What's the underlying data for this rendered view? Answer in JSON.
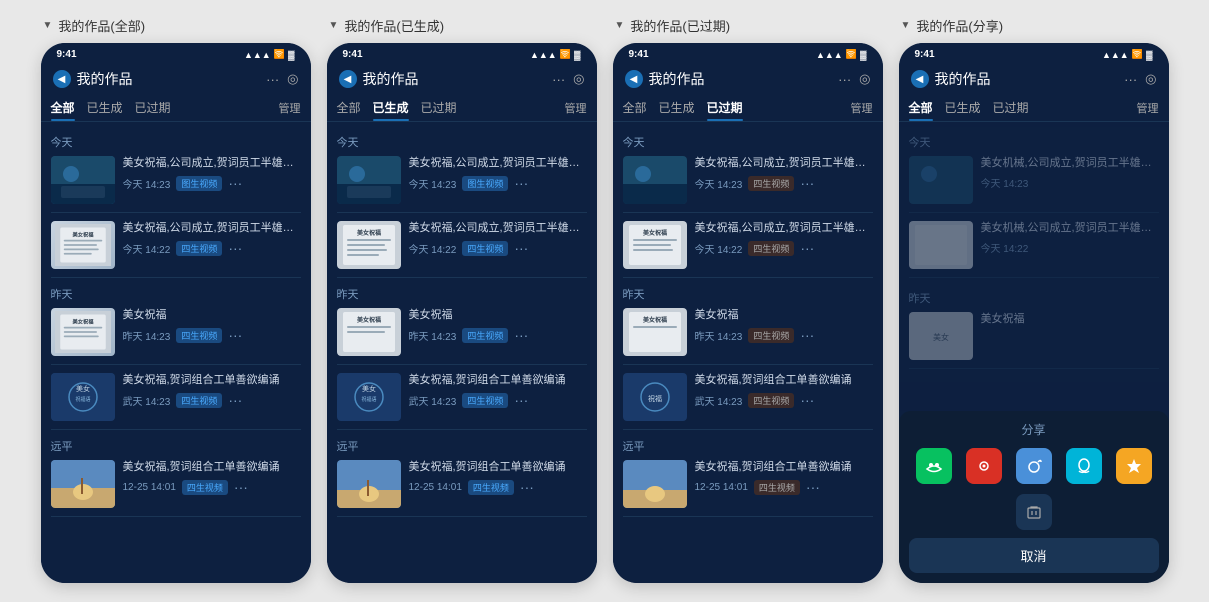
{
  "sections": [
    {
      "id": "all",
      "title": "我的作品(全部)",
      "tabs": [
        "全部",
        "已生成",
        "已过期"
      ],
      "activeTab": 0,
      "manageLabel": "管理"
    },
    {
      "id": "generated",
      "title": "我的作品(已生成)",
      "tabs": [
        "全部",
        "已生成",
        "已过期"
      ],
      "activeTab": 1,
      "manageLabel": "管理"
    },
    {
      "id": "expired",
      "title": "我的作品(已过期)",
      "tabs": [
        "全部",
        "已生成",
        "已过期"
      ],
      "activeTab": 2,
      "manageLabel": "管理"
    },
    {
      "id": "share",
      "title": "我的作品(分享)",
      "tabs": [
        "全部",
        "已生成",
        "已过期"
      ],
      "activeTab": 0,
      "manageLabel": "管理"
    }
  ],
  "header": {
    "title": "我的作品",
    "backLabel": "←",
    "moreLabel": "···",
    "settingLabel": "◎"
  },
  "statusBar": {
    "time": "9:41",
    "icons": "📶🔋"
  },
  "dateSections": {
    "today": "今天",
    "yesterday": "昨天",
    "earlier": "远平"
  },
  "workItems": [
    {
      "id": 1,
      "title": "美女祝福,公司成立,贺词员工半雄改福迪,智能生成",
      "time": "今天 14:23",
      "status": "图生视频",
      "statusType": "generated",
      "thumbType": "photo"
    },
    {
      "id": 2,
      "title": "美女祝福,公司成立,贺词员工半雄改福迪,智能生成",
      "time": "今天 14:22",
      "status": "四生视频",
      "statusType": "generated",
      "thumbType": "card"
    },
    {
      "id": 3,
      "title": "美女祝福",
      "time": "昨天 14:23",
      "status": "四生视频",
      "statusType": "generated",
      "thumbType": "card"
    },
    {
      "id": 4,
      "title": "美女祝福,贺词组合工单善欲编诵",
      "time": "武天 14:23",
      "status": "四生视频",
      "statusType": "generated",
      "thumbType": "blue-poster"
    },
    {
      "id": 5,
      "title": "美女祝福,贺词组合工单善欲编诵",
      "time": "12-25 14:01",
      "status": "四生视频",
      "statusType": "generated",
      "thumbType": "beach"
    }
  ],
  "sharePanel": {
    "sectionLabel": "分享",
    "cancelLabel": "取消",
    "apps": [
      {
        "id": "wechat",
        "label": "微信",
        "color": "green"
      },
      {
        "id": "moments",
        "label": "朋友圈",
        "color": "red"
      },
      {
        "id": "weibo",
        "label": "微博",
        "color": "blue"
      },
      {
        "id": "qq",
        "label": "QQ",
        "color": "teal"
      },
      {
        "id": "favorites",
        "label": "收藏",
        "color": "yellow"
      }
    ],
    "actions": [
      {
        "id": "delete",
        "label": "🗑"
      }
    ]
  },
  "expiredStatus": "四生视频",
  "colors": {
    "bg": "#0d2040",
    "accent": "#1a6fb5",
    "text": "#d0dae8",
    "subtext": "#7a9bbf",
    "border": "#1a3555"
  }
}
